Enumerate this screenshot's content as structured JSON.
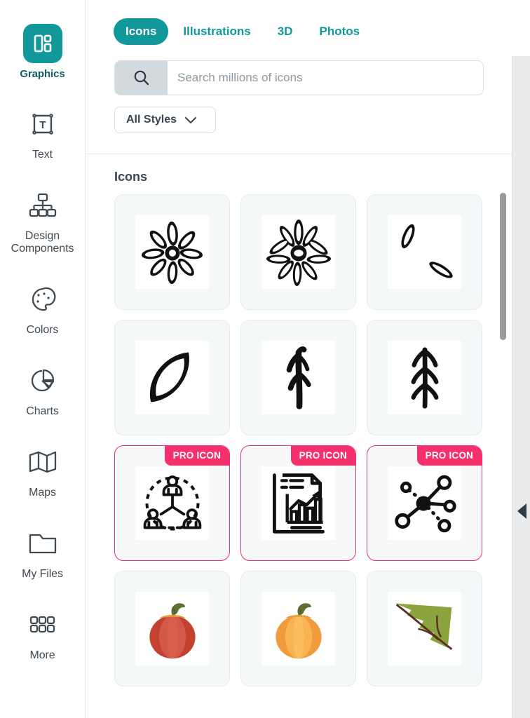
{
  "sidebar": {
    "items": [
      {
        "label": "Graphics",
        "icon": "graphics-icon",
        "active": true
      },
      {
        "label": "Text",
        "icon": "text-box-icon",
        "active": false
      },
      {
        "label": "Design\nComponents",
        "icon": "design-components-icon",
        "active": false
      },
      {
        "label": "Colors",
        "icon": "palette-icon",
        "active": false
      },
      {
        "label": "Charts",
        "icon": "pie-chart-icon",
        "active": false
      },
      {
        "label": "Maps",
        "icon": "map-icon",
        "active": false
      },
      {
        "label": "My Files",
        "icon": "folder-icon",
        "active": false
      },
      {
        "label": "More",
        "icon": "grid-dots-icon",
        "active": false
      }
    ]
  },
  "panel": {
    "tabs": [
      {
        "label": "Icons",
        "active": true
      },
      {
        "label": "Illustrations",
        "active": false
      },
      {
        "label": "3D",
        "active": false
      },
      {
        "label": "Photos",
        "active": false
      }
    ],
    "search": {
      "placeholder": "Search millions of icons",
      "value": "",
      "icon": "search-icon"
    },
    "filter": {
      "label": "All Styles",
      "icon": "chevron-down-icon"
    },
    "section_title": "Icons",
    "results": [
      {
        "id": "icon-flower-sketch-1",
        "name": "flower-sketch-icon",
        "pro": false,
        "badge": ""
      },
      {
        "id": "icon-flower-sketch-2",
        "name": "daisy-sketch-icon",
        "pro": false,
        "badge": ""
      },
      {
        "id": "icon-two-leaves-sketch",
        "name": "two-leaves-sketch-icon",
        "pro": false,
        "badge": ""
      },
      {
        "id": "icon-leaf-outline-sketch",
        "name": "leaf-outline-sketch-icon",
        "pro": false,
        "badge": ""
      },
      {
        "id": "icon-branch-sketch-1",
        "name": "branch-sketch-icon",
        "pro": false,
        "badge": ""
      },
      {
        "id": "icon-fir-tree-sketch",
        "name": "fir-tree-sketch-icon",
        "pro": false,
        "badge": ""
      },
      {
        "id": "icon-team-network",
        "name": "team-network-icon",
        "pro": true,
        "badge": "PRO ICON"
      },
      {
        "id": "icon-report-chart",
        "name": "report-chart-icon",
        "pro": true,
        "badge": "PRO ICON"
      },
      {
        "id": "icon-node-network",
        "name": "node-network-icon",
        "pro": true,
        "badge": "PRO ICON"
      },
      {
        "id": "icon-red-pumpkin",
        "name": "red-pumpkin-icon",
        "pro": false,
        "badge": ""
      },
      {
        "id": "icon-orange-pumpkin",
        "name": "orange-pumpkin-icon",
        "pro": false,
        "badge": ""
      },
      {
        "id": "icon-green-leaf",
        "name": "green-leaf-icon",
        "pro": false,
        "badge": ""
      }
    ]
  },
  "canvas": {
    "collapse_icon": "collapse-panel-arrow-icon"
  },
  "colors": {
    "teal": "#12989a",
    "teal_dark": "#0f5e63",
    "pink": "#f4306d",
    "text_dark": "#3b4752",
    "card_bg": "#f5f8f8",
    "card_border": "#e6ecee",
    "search_btn_bg": "#d3dade",
    "scrollbar": "#9a9a9a"
  }
}
